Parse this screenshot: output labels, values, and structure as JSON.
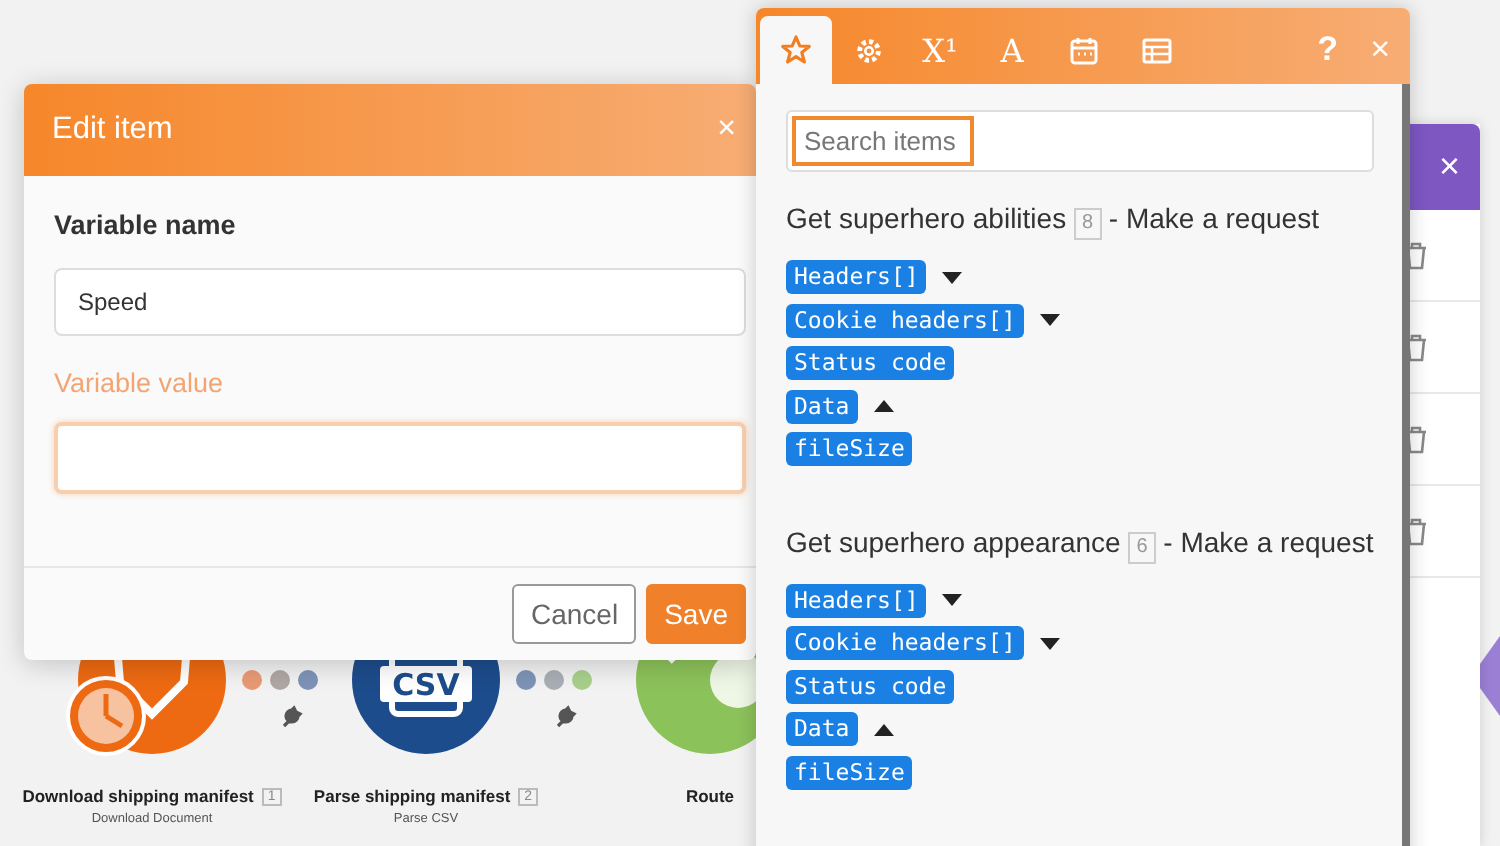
{
  "canvas": {
    "nodes": [
      {
        "kind": "download",
        "title": "Download shipping manifest",
        "number": "1",
        "subtitle": "Download Document"
      },
      {
        "kind": "csv",
        "icon_text": "CSV",
        "title": "Parse shipping manifest",
        "number": "2",
        "subtitle": "Parse CSV"
      },
      {
        "kind": "router",
        "title": "Route"
      }
    ]
  },
  "side_panel": {
    "close": "×"
  },
  "edit_dialog": {
    "title": "Edit item",
    "close": "×",
    "fields": [
      {
        "label": "Variable name",
        "value": "Speed",
        "focused": false
      },
      {
        "label": "Variable value",
        "focused": true
      }
    ],
    "buttons": [
      {
        "label": "Cancel",
        "kind": "secondary"
      },
      {
        "label": "Save",
        "kind": "primary"
      }
    ]
  },
  "mapping_panel": {
    "tabs": [
      {
        "kind": "star",
        "selected": true
      },
      {
        "kind": "gear",
        "selected": false
      },
      {
        "kind": "math",
        "label": "X¹",
        "selected": false
      },
      {
        "kind": "text",
        "label": "A",
        "selected": false
      },
      {
        "kind": "calendar",
        "selected": false
      },
      {
        "kind": "table",
        "selected": false
      }
    ],
    "help": "?",
    "close": "×",
    "search": {
      "placeholder": "Search items",
      "focused": true
    },
    "sections": [
      {
        "title": "Get superhero abilities",
        "count": "8",
        "suffix": "- Make a request",
        "items": [
          {
            "label": "Headers[]",
            "expanded": false
          },
          {
            "label": "Cookie headers[]",
            "expanded": false
          },
          {
            "label": "Status code"
          },
          {
            "label": "Data",
            "expanded": true
          },
          {
            "label": "fileSize"
          }
        ]
      },
      {
        "title": "Get superhero appearance",
        "count": "6",
        "suffix": "- Make a request",
        "items": [
          {
            "label": "Headers[]",
            "expanded": false
          },
          {
            "label": "Cookie headers[]",
            "expanded": false
          },
          {
            "label": "Status code"
          },
          {
            "label": "Data",
            "expanded": true
          },
          {
            "label": "fileSize"
          }
        ]
      }
    ]
  }
}
